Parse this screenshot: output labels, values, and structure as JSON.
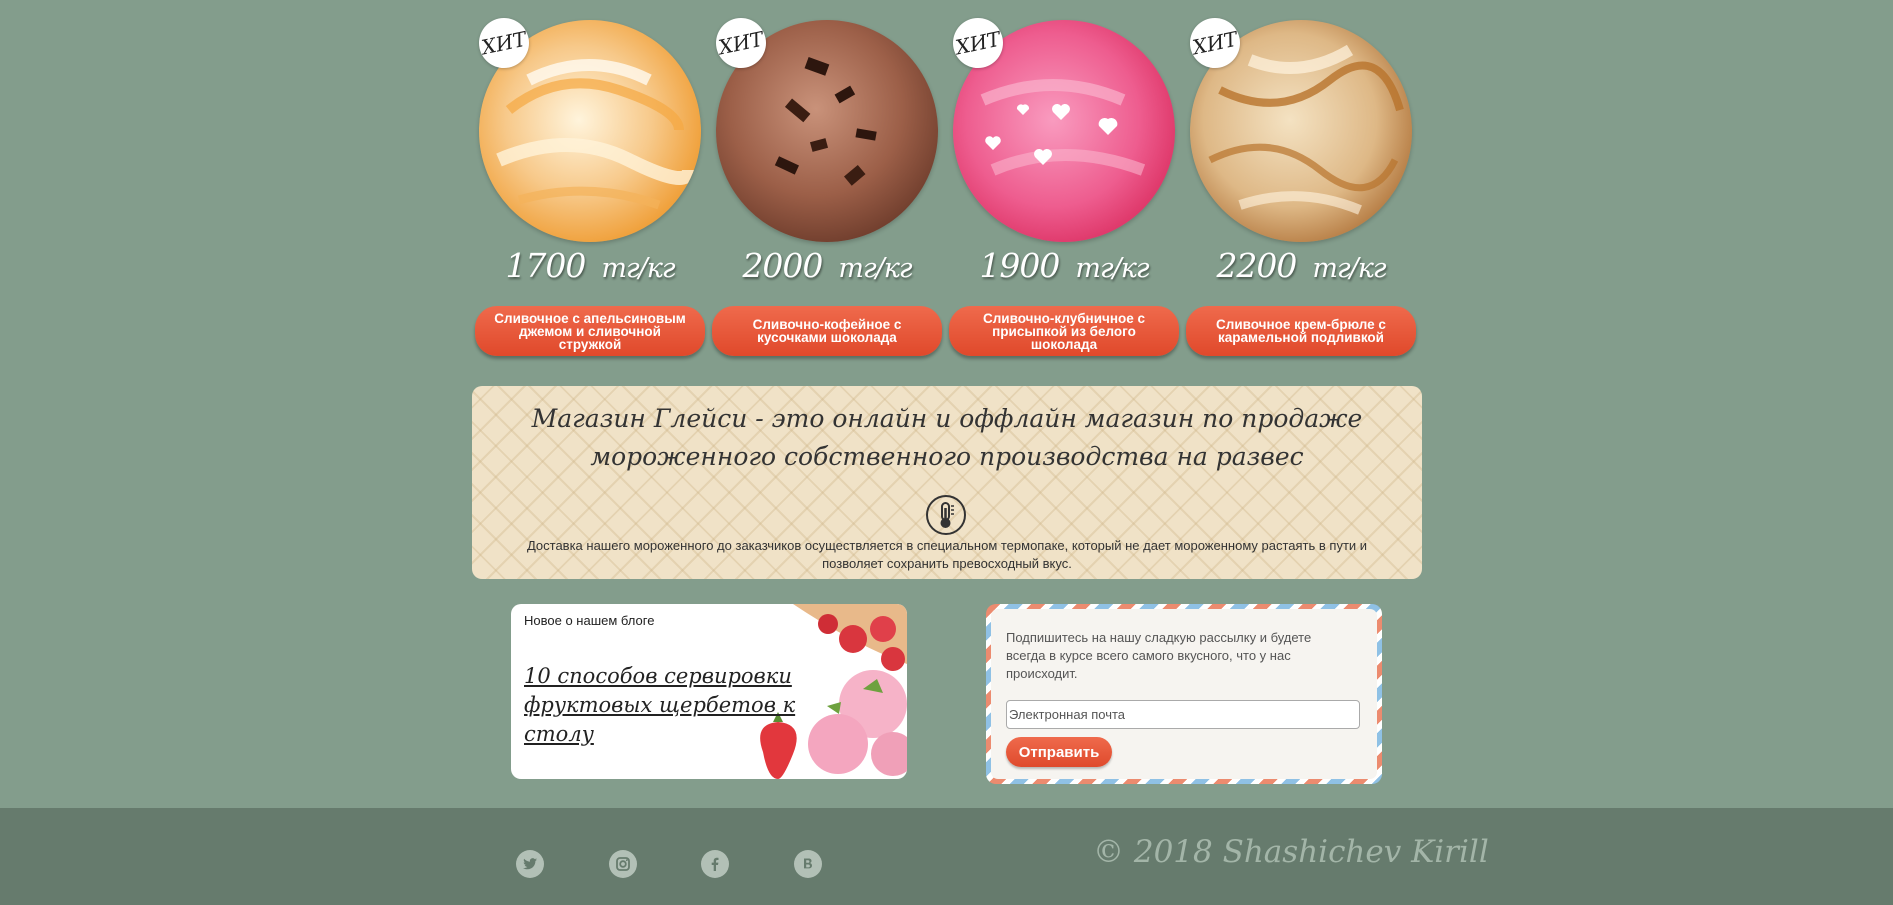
{
  "products": [
    {
      "badge": "ХИТ",
      "price": "1700",
      "unit": "тг/кг",
      "name": "Сливочное с апельсиновым джемом и сливочной стружкой"
    },
    {
      "badge": "ХИТ",
      "price": "2000",
      "unit": "тг/кг",
      "name": "Сливочно-кофейное с кусочками шоколада"
    },
    {
      "badge": "ХИТ",
      "price": "1900",
      "unit": "тг/кг",
      "name": "Сливочно-клубничное с присыпкой из белого шоколада"
    },
    {
      "badge": "ХИТ",
      "price": "2200",
      "unit": "тг/кг",
      "name": "Сливочное крем-брюле с карамельной подливкой"
    }
  ],
  "about": {
    "title": "Магазин Глейси - это онлайн и оффлайн магазин по продаже мороженного собственного производства на развес",
    "icon": "thermometer-icon",
    "text": "Доставка нашего мороженного до заказчиков осуществляется в специальном термопаке, который не дает мороженному растаять в пути и позволяет сохранить превосходный вкус."
  },
  "blog": {
    "heading": "Новое о нашем блоге",
    "link": "10 способов сервировки фруктовых щербетов к столу"
  },
  "subscribe": {
    "text": "Подпишитесь на нашу сладкую рассылку и будете всегда в курсе всего самого вкусного, что у нас происходит.",
    "email_placeholder": "Электронная почта",
    "button": "Отправить"
  },
  "footer": {
    "socials": [
      "twitter-icon",
      "instagram-icon",
      "facebook-icon",
      "vk-icon"
    ],
    "copyright": "© 2018 Shashichev Kirill"
  },
  "colors": {
    "background": "#839d8c",
    "footer": "#667b6d",
    "accent": "#e9573a",
    "wafer": "#f0e2c7"
  }
}
